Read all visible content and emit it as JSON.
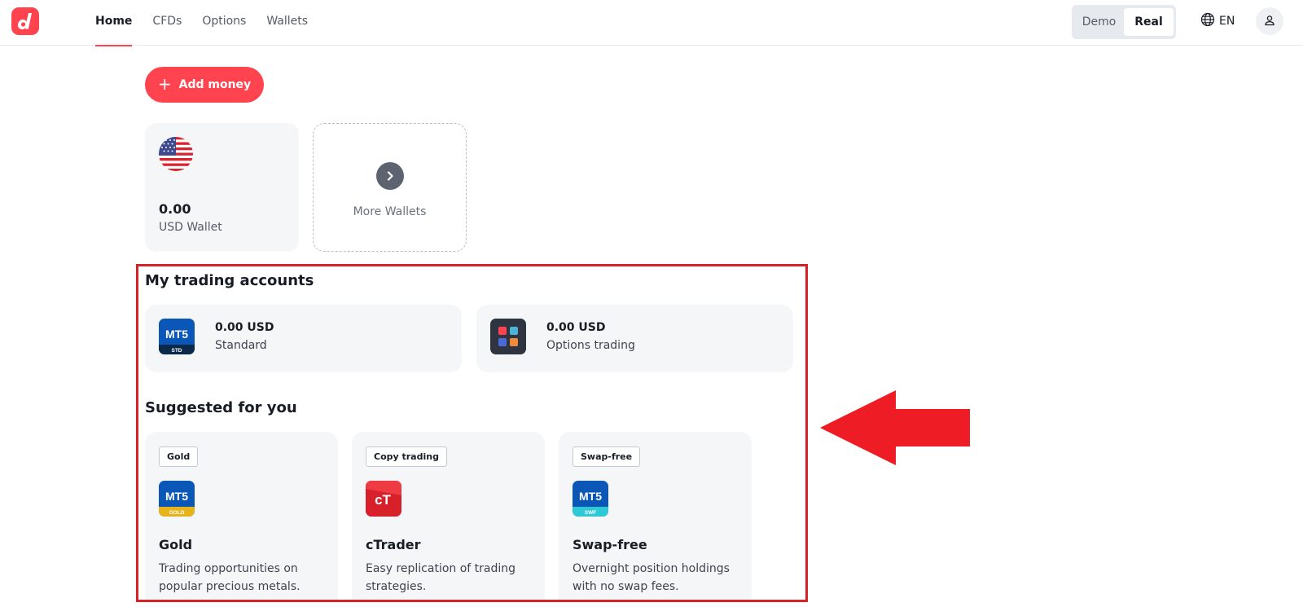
{
  "nav": {
    "items": [
      {
        "label": "Home",
        "active": true
      },
      {
        "label": "CFDs",
        "active": false
      },
      {
        "label": "Options",
        "active": false
      },
      {
        "label": "Wallets",
        "active": false
      }
    ]
  },
  "mode_toggle": {
    "demo": "Demo",
    "real": "Real",
    "selected": "Real"
  },
  "language": {
    "code": "EN"
  },
  "actions": {
    "add_money": "Add money"
  },
  "wallets": {
    "usd": {
      "balance": "0.00",
      "name": "USD Wallet"
    },
    "more": {
      "label": "More Wallets"
    }
  },
  "trading_accounts": {
    "title": "My trading accounts",
    "items": [
      {
        "balance": "0.00 USD",
        "name": "Standard",
        "icon_text": "MT5",
        "icon_sub": "STD"
      },
      {
        "balance": "0.00 USD",
        "name": "Options trading"
      }
    ]
  },
  "suggested": {
    "title": "Suggested for you",
    "items": [
      {
        "tag": "Gold",
        "icon_text": "MT5",
        "icon_sub": "GOLD",
        "title": "Gold",
        "desc": "Trading opportunities on popular precious metals."
      },
      {
        "tag": "Copy trading",
        "icon_text": "cT",
        "title": "cTrader",
        "desc": "Easy replication of trading strategies."
      },
      {
        "tag": "Swap-free",
        "icon_text": "MT5",
        "icon_sub": "SWF",
        "title": "Swap-free",
        "desc": "Overnight position holdings with no swap fees."
      }
    ]
  },
  "colors": {
    "brand": "#ff444f",
    "highlight": "#d7222a",
    "arrow": "#ee1c25"
  }
}
